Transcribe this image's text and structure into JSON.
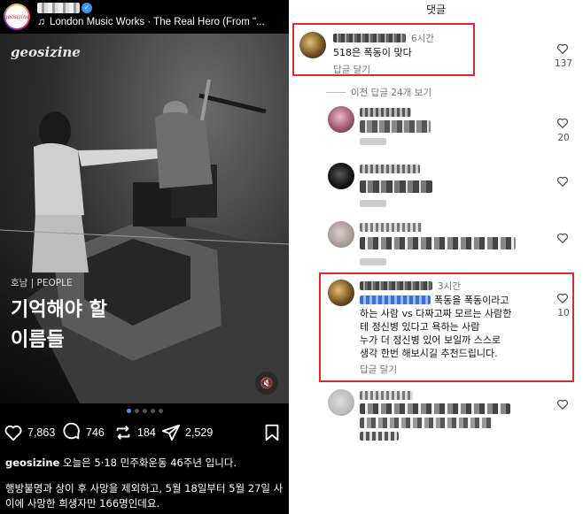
{
  "post": {
    "account_logo_text": "geosizine",
    "music": "London Music Works · The Real Hero (From \"...",
    "photo_logo": "geosizine",
    "category": "호남 | PEOPLE",
    "headline_1": "기억해야 할",
    "headline_2": "이름들",
    "likes": "7,863",
    "comments": "746",
    "reposts": "184",
    "shares": "2,529",
    "caption_user": "geosizine",
    "caption_text": " 오늘은 5·18 민주화운동 46주년 입니다.",
    "caption_more": "행방불명과 상이 후 사망을 제외하고, 5월 18일부터 5월 27일 사이에 사망한 희생자만 166명인데요."
  },
  "comments_panel": {
    "title": "댓글",
    "view_previous": "이전 답글 24개 보기",
    "reply_label": "답글 달기",
    "comments": [
      {
        "time": "6시간",
        "text": "518은 폭동이 맞다",
        "likes": "137"
      },
      {
        "likes": "20"
      },
      {
        "likes": ""
      },
      {
        "likes": ""
      },
      {
        "time": "3시간",
        "text": "폭동을 폭동이라고 하는 사람 vs 다짜고짜 모르는 사람한테 정신병 있다고 욕하는 사람\n누가 더 정신병 있어 보일까 스스로 생각 한번 해보시길 추천드립니다.",
        "likes": "10"
      },
      {
        "likes": ""
      }
    ]
  },
  "colors": {
    "highlight": "#e3252c",
    "link_blue": "#3897f0"
  }
}
